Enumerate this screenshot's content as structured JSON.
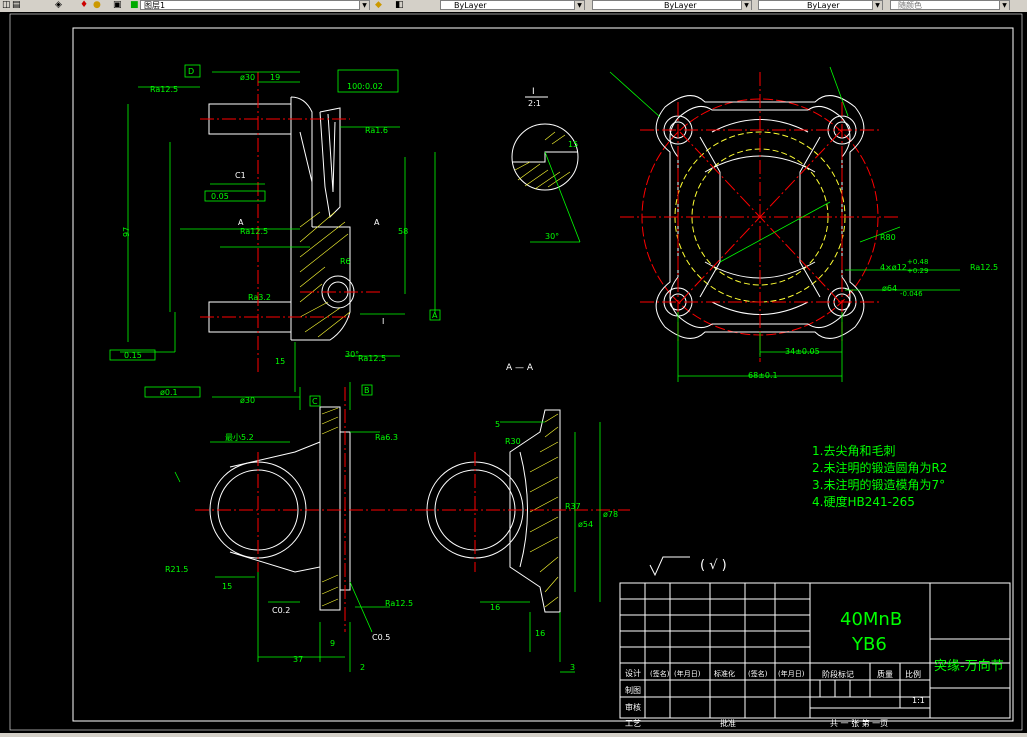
{
  "toolbar": {
    "layer_name": "图层1",
    "color_combo": "ByLayer",
    "linetype_combo": "ByLayer",
    "lineweight_combo": "ByLayer",
    "plotstyle_combo": "随颜色"
  },
  "drawing": {
    "material": "40MnB",
    "code": "YB6",
    "part_name": "突缘-万向节",
    "scale": "1:1",
    "sheets": "共  一  张  第  一页",
    "section_label": "A — A",
    "view_label_top": "I",
    "view_label_bottom": "2:1",
    "notes": [
      "1.去尖角和毛刺",
      "2.未注明的锻造圆角为R2",
      "3.未注明的锻造模角为7°",
      "4.硬度HB241-265"
    ],
    "roughness_symbol": "(  √  )",
    "title_block": {
      "row1": [
        "设计",
        "(签名)",
        "(年月日)",
        "标准化",
        "(签名)",
        "(年月日)"
      ],
      "row2": [
        "制图"
      ],
      "row3": [
        "审核"
      ],
      "row4": [
        "工艺",
        "",
        "",
        "批准"
      ],
      "stage_label": "阶段标记",
      "weight_label": "质量",
      "ratio_label": "比例"
    },
    "dims": {
      "ra125": "Ra12.5",
      "ra16": "Ra1.6",
      "ra32": "Ra3.2",
      "ra63": "Ra6.3",
      "d30": "ø30",
      "d97": "97",
      "d58": "58",
      "d19": "19",
      "c1": "C1",
      "r6": "R6",
      "d30deg": "30°",
      "d15": "15",
      "r80": "R80",
      "d34": "34±0.05",
      "d68": "68±0.1",
      "holes": "4×ø12",
      "tol1": "+0.48",
      "tol2": "+0.29",
      "bore": "ø64",
      "bore_tol": "-0.046",
      "min52": "最小5.2",
      "r215": "R21.5",
      "c02": "C0.2",
      "c05": "C0.5",
      "d37": "37",
      "d9": "9",
      "d2": "2",
      "d16": "16",
      "d3": "3",
      "d5": "5",
      "r30": "R30",
      "r37": "R37",
      "d54": "ø54",
      "d78": "ø78",
      "gtol1": "0.05",
      "gtol2": "0.15",
      "gtol3": "100:0.02",
      "gtol4": "ø0.1",
      "label_a": "A",
      "label_b": "B",
      "label_c": "C",
      "label_d": "D",
      "label_i": "I"
    }
  }
}
